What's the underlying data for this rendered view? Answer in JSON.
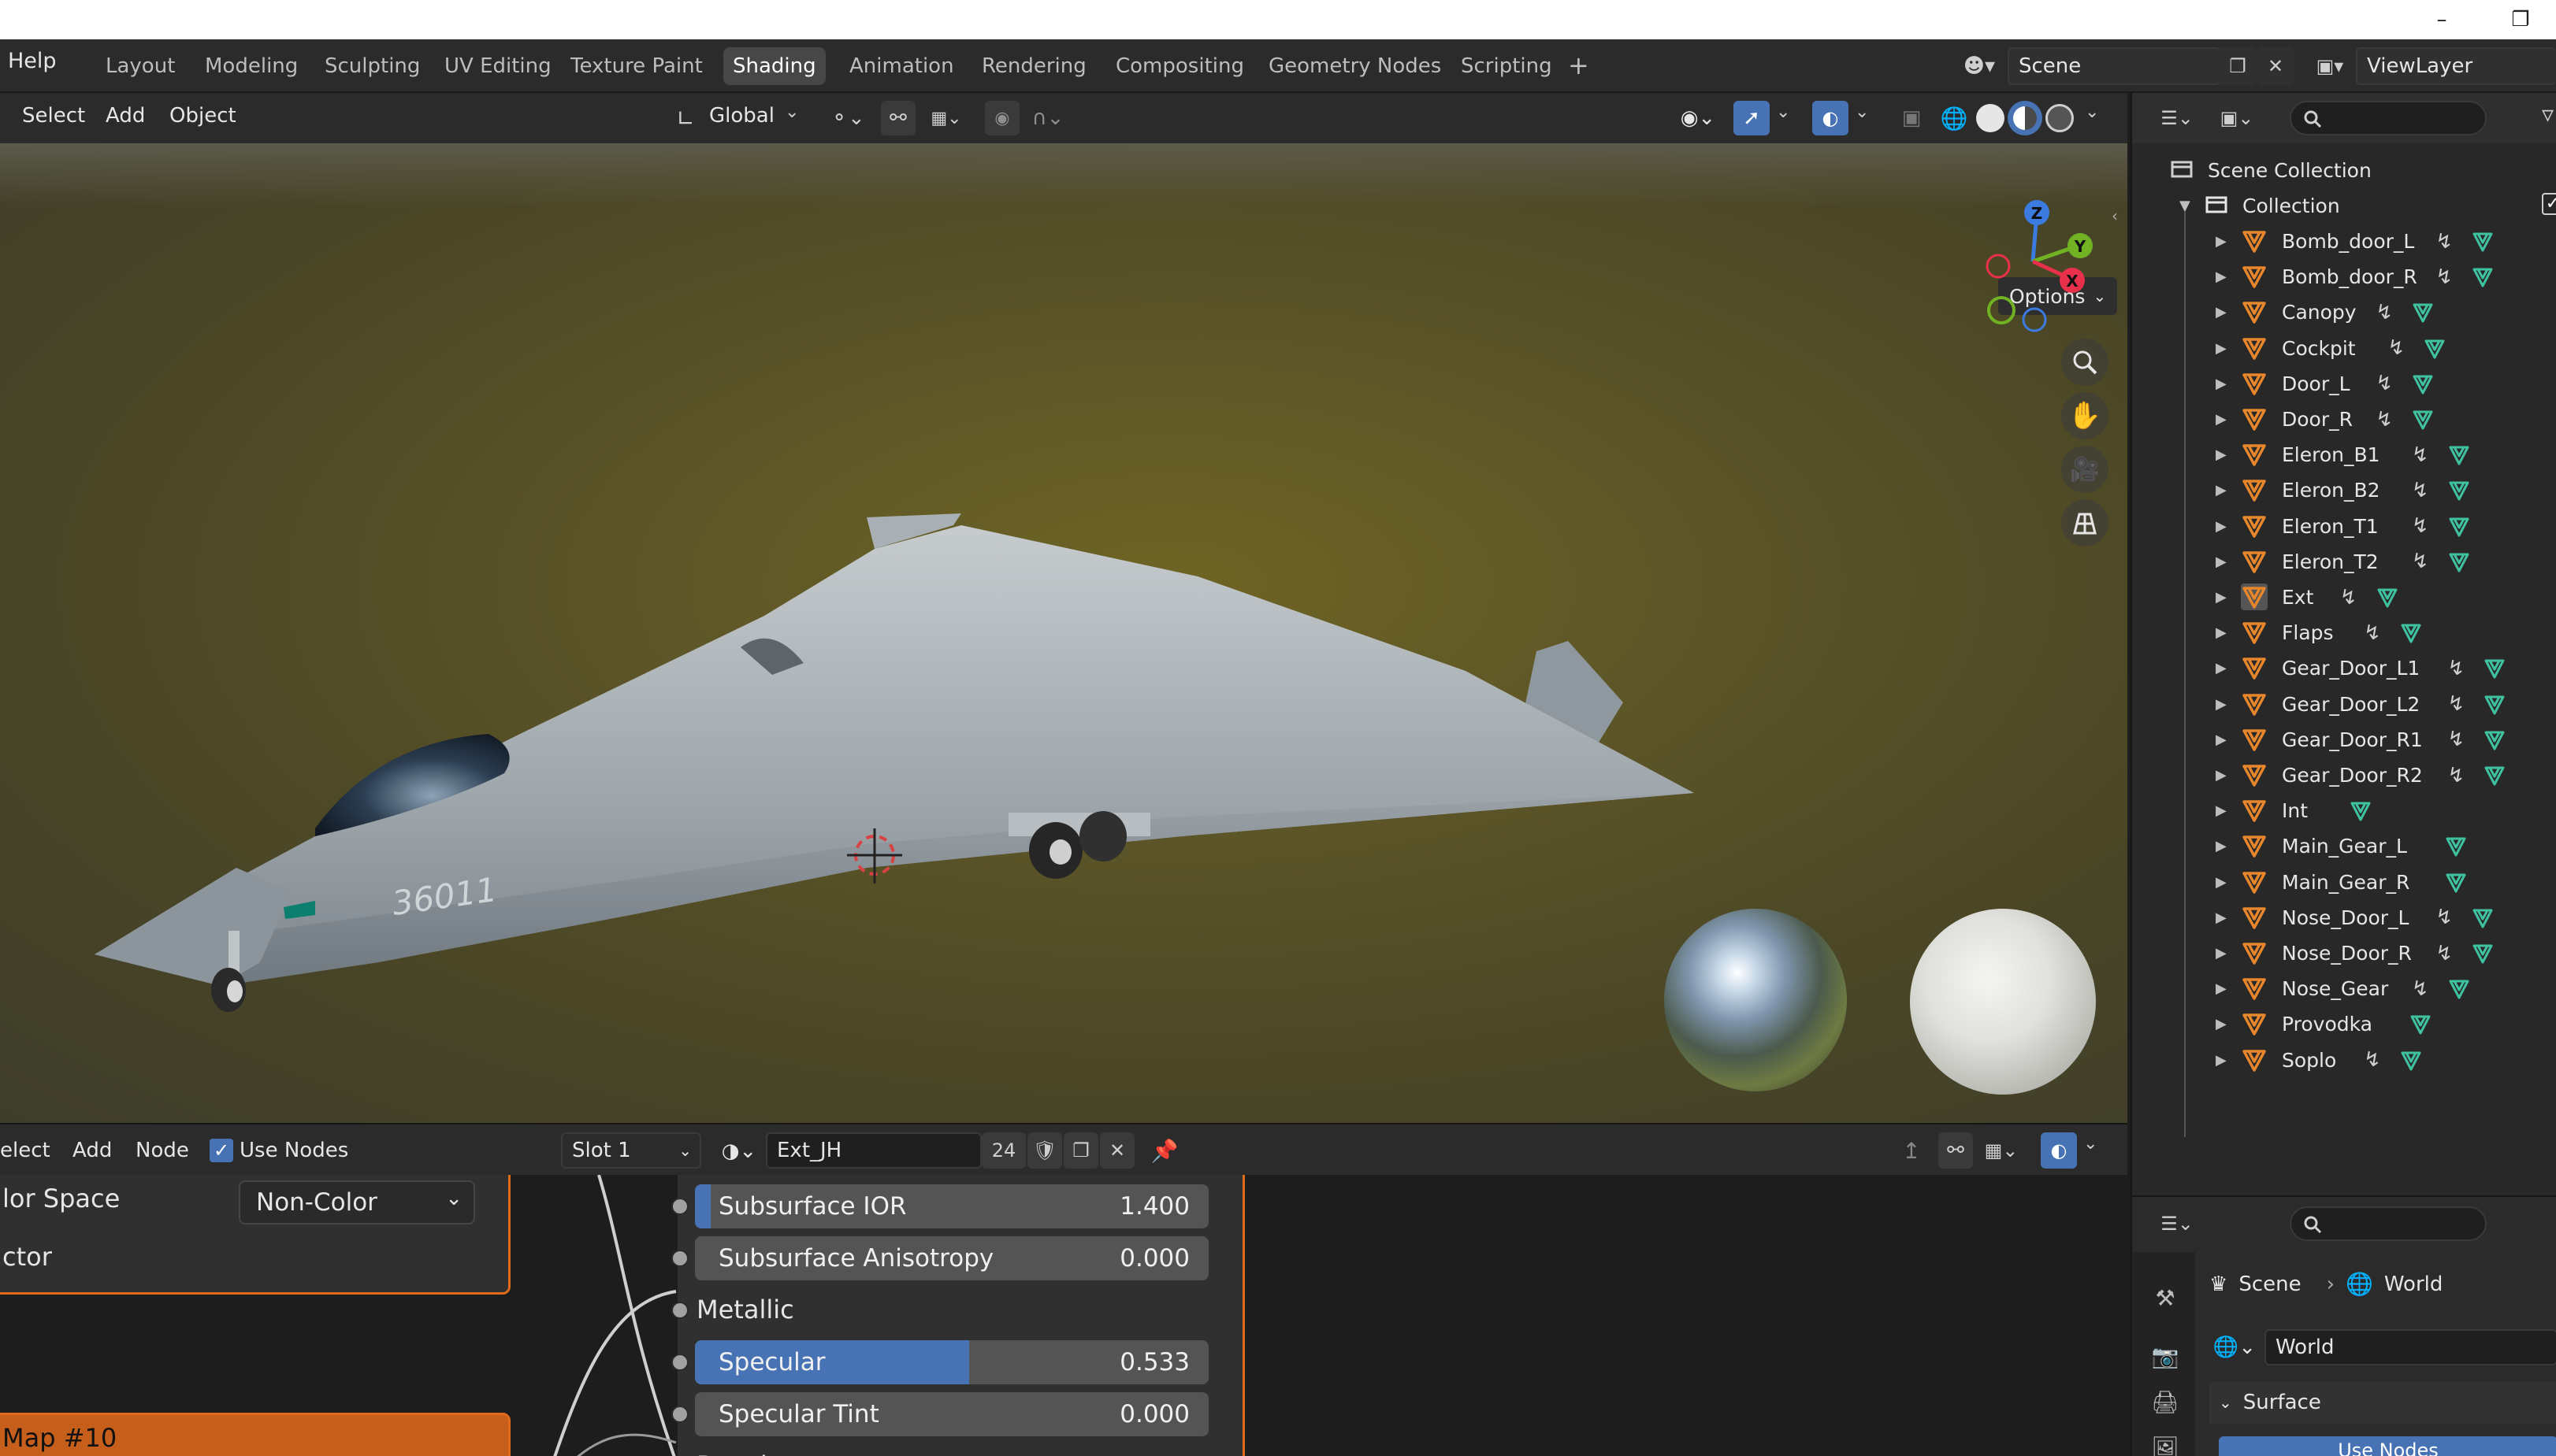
{
  "topbar": {
    "help": "Help",
    "workspaces": [
      "Layout",
      "Modeling",
      "Sculpting",
      "UV Editing",
      "Texture Paint",
      "Shading",
      "Animation",
      "Rendering",
      "Compositing",
      "Geometry Nodes",
      "Scripting"
    ],
    "active_workspace": "Shading",
    "add_tab": "+",
    "scene_name": "Scene",
    "view_layer": "ViewLayer"
  },
  "viewport_header": {
    "menus": [
      "Select",
      "Add",
      "Object"
    ],
    "orientation": "Global",
    "options": "Options"
  },
  "gizmo": {
    "z": "Z",
    "y": "Y",
    "x": "X"
  },
  "aircraft_marking": "36011",
  "outliner": {
    "scene_collection": "Scene Collection",
    "collection": "Collection",
    "items": [
      {
        "name": "Bomb_door_L",
        "modifier": true
      },
      {
        "name": "Bomb_door_R",
        "modifier": true
      },
      {
        "name": "Canopy",
        "modifier": true
      },
      {
        "name": "Cockpit",
        "modifier": true
      },
      {
        "name": "Door_L",
        "modifier": true
      },
      {
        "name": "Door_R",
        "modifier": true
      },
      {
        "name": "Eleron_B1",
        "modifier": true
      },
      {
        "name": "Eleron_B2",
        "modifier": true
      },
      {
        "name": "Eleron_T1",
        "modifier": true
      },
      {
        "name": "Eleron_T2",
        "modifier": true
      },
      {
        "name": "Ext",
        "modifier": true
      },
      {
        "name": "Flaps",
        "modifier": true
      },
      {
        "name": "Gear_Door_L1",
        "modifier": true
      },
      {
        "name": "Gear_Door_L2",
        "modifier": true
      },
      {
        "name": "Gear_Door_R1",
        "modifier": true
      },
      {
        "name": "Gear_Door_R2",
        "modifier": true
      },
      {
        "name": "Int",
        "modifier": false
      },
      {
        "name": "Main_Gear_L",
        "modifier": false
      },
      {
        "name": "Main_Gear_R",
        "modifier": false
      },
      {
        "name": "Nose_Door_L",
        "modifier": true
      },
      {
        "name": "Nose_Door_R",
        "modifier": true
      },
      {
        "name": "Nose_Gear",
        "modifier": true
      },
      {
        "name": "Provodka",
        "modifier": false
      },
      {
        "name": "Soplo",
        "modifier": true
      }
    ]
  },
  "node_header": {
    "menus": [
      "elect",
      "Add",
      "Node"
    ],
    "use_nodes_label": "Use Nodes",
    "slot": "Slot 1",
    "material": "Ext_JH",
    "users": "24"
  },
  "nodes": {
    "left_node": {
      "color_space_label": "lor Space",
      "color_space_value": "Non-Color",
      "vector_label": "ctor",
      "map_title": "Map #10"
    },
    "bsdf": [
      {
        "name": "Subsurface IOR",
        "value": "1.400",
        "fill": 0.03
      },
      {
        "name": "Subsurface Anisotropy",
        "value": "0.000",
        "fill": 0
      },
      {
        "name": "Metallic",
        "value": null,
        "fill": null
      },
      {
        "name": "Specular",
        "value": "0.533",
        "fill": 0.533
      },
      {
        "name": "Specular Tint",
        "value": "0.000",
        "fill": 0
      },
      {
        "name": "Roughness",
        "value": null,
        "fill": null
      }
    ]
  },
  "properties": {
    "breadcrumb_scene": "Scene",
    "breadcrumb_world": "World",
    "world_name": "World",
    "surface_panel": "Surface",
    "use_nodes_button": "Use Nodes"
  },
  "colors": {
    "active_blue": "#4772b3",
    "node_orange": "#e06a1c",
    "mesh_orange": "#e8862c",
    "data_green": "#3fc2a0"
  }
}
